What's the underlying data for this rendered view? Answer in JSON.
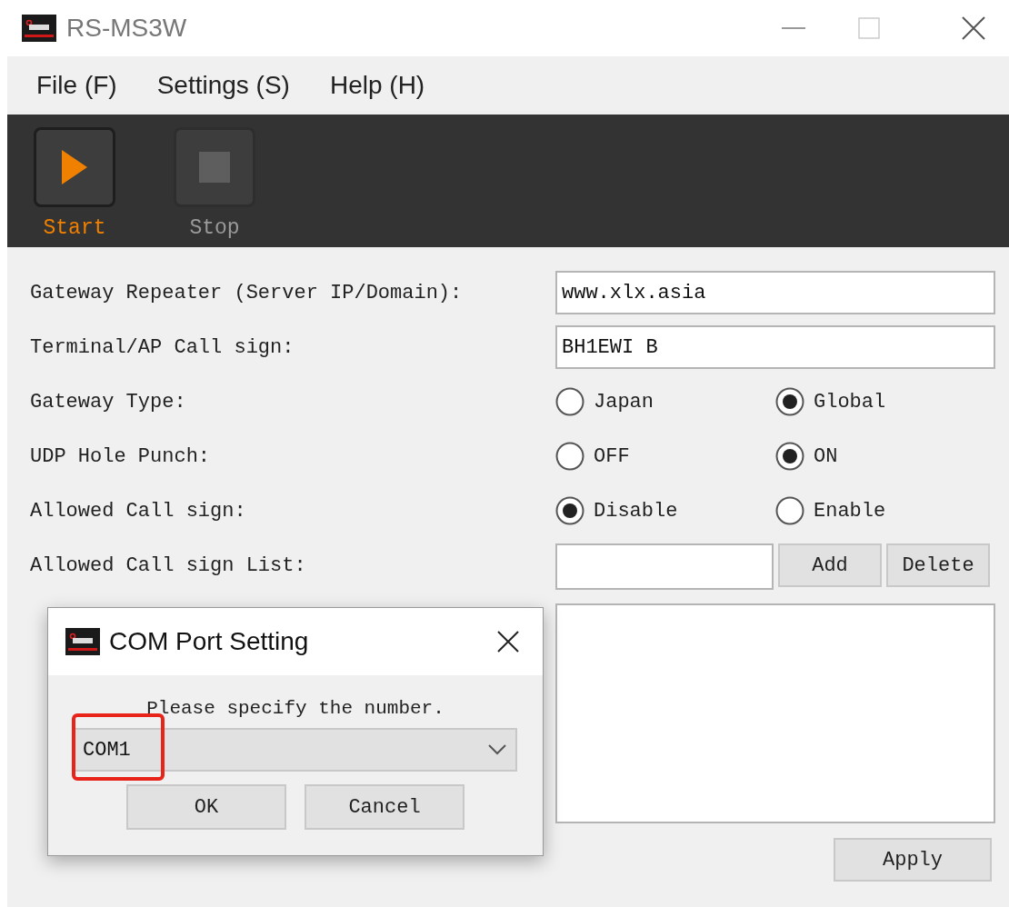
{
  "window": {
    "title": "RS-MS3W"
  },
  "menu": [
    "File (F)",
    "Settings (S)",
    "Help (H)"
  ],
  "toolbar": [
    {
      "label": "Start",
      "kind": "play",
      "enabled": true
    },
    {
      "label": "Stop",
      "kind": "stop",
      "enabled": false
    }
  ],
  "form": [
    {
      "kind": "text",
      "label": "Gateway Repeater (Server IP/Domain):",
      "value": "www.xlx.asia"
    },
    {
      "kind": "text",
      "label": "Terminal/AP Call sign:",
      "value": "BH1EWI B"
    },
    {
      "kind": "radio",
      "label": "Gateway Type:",
      "options": [
        {
          "label": "Japan",
          "selected": false
        },
        {
          "label": "Global",
          "selected": true
        }
      ]
    },
    {
      "kind": "radio",
      "label": "UDP Hole Punch:",
      "options": [
        {
          "label": "OFF",
          "selected": false
        },
        {
          "label": "ON",
          "selected": true
        }
      ]
    },
    {
      "kind": "radio",
      "label": "Allowed Call sign:",
      "options": [
        {
          "label": "Disable",
          "selected": true
        },
        {
          "label": "Enable",
          "selected": false
        }
      ]
    },
    {
      "kind": "list_entry",
      "label": "Allowed Call sign List:",
      "buttons": [
        "Add",
        "Delete"
      ]
    }
  ],
  "apply_button": "Apply",
  "dialog": {
    "title": "COM Port Setting",
    "prompt": "Please specify the number.",
    "port": "COM1",
    "buttons": [
      "OK",
      "Cancel"
    ],
    "highlight": true
  }
}
